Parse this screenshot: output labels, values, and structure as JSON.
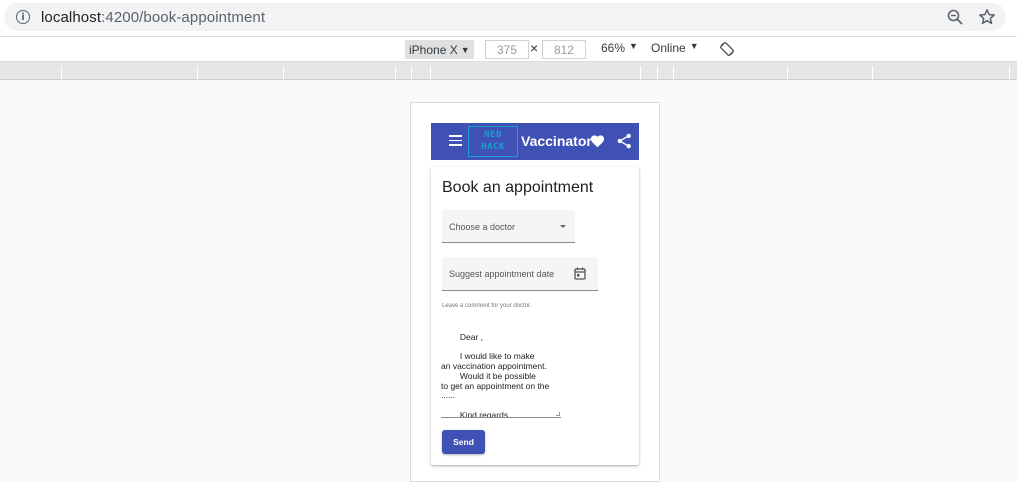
{
  "browser": {
    "url_host": "localhost",
    "url_path": ":4200/book-appointment"
  },
  "devtools": {
    "device": "iPhone X",
    "width": "375",
    "height": "812",
    "times_symbol": "×",
    "zoom": "66%",
    "throttle": "Online",
    "dropdown_arrow": "▼"
  },
  "app": {
    "logo_line1": "NED",
    "logo_line2": "HACK",
    "title": "Vaccinator"
  },
  "form": {
    "heading": "Book an appointment",
    "doctor_placeholder": "Choose a doctor",
    "date_placeholder": "Suggest appointment date",
    "comment_label": "Leave a comment for your doctor.",
    "comment_text": "        Dear ,\n\n        I would like to make\nan vaccination appointment.\n        Would it be possible\nto get an appointment on the\n......\n\n        Kind regards,\n        Hermine Granger",
    "send_label": "Send"
  },
  "colors": {
    "primary": "#3f51b5",
    "logo_accent": "#1aa0c8"
  }
}
